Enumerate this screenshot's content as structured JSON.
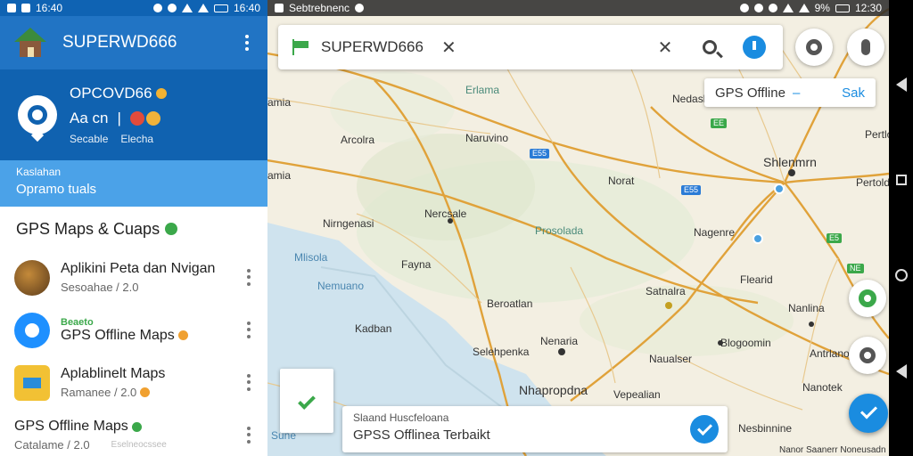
{
  "left_status": {
    "time": "16:40"
  },
  "map_status": {
    "title": "Sebtrebnenc",
    "battery": "9%",
    "time": "12:30"
  },
  "app": {
    "title": "SUPERWD666"
  },
  "profile": {
    "name": "OPCOVD66",
    "row": "Aa cn",
    "sub_left": "Secable",
    "sub_right": "Elecha"
  },
  "promo": {
    "small": "Kaslahan",
    "big": "Opramo tuals"
  },
  "list": {
    "header": "GPS Maps & Cuaps",
    "items": [
      {
        "tag": "",
        "title": "Aplikini Peta dan Nvigan",
        "sub": "Sesoahae / 2.0",
        "icon": "brown-app-icon"
      },
      {
        "tag": "Beaeto",
        "title": "GPS Offline Maps",
        "sub": "",
        "icon": "blue-app-icon"
      },
      {
        "tag": "",
        "title": "Aplablinelt Maps",
        "sub": "Ramanee / 2.0",
        "icon": "yellow-app-icon"
      },
      {
        "tag": "",
        "title": "GPS Offline Maps",
        "sub": "Catalame / 2.0",
        "icon": "map-app-icon"
      }
    ],
    "footer_watermark": "Eselneocssee"
  },
  "search": {
    "text": "SUPERWD666"
  },
  "chip": {
    "label": "GPS Offline",
    "sep": "–",
    "action": "Sak"
  },
  "toast": {
    "small": "Slaand Huscfeloana",
    "big": "GPSS Offlinea Terbaikt"
  },
  "map": {
    "labels": [
      {
        "text": "Erlama",
        "cls": "region"
      },
      {
        "text": "amia",
        "cls": ""
      },
      {
        "text": "Nedasla",
        "cls": ""
      },
      {
        "text": "Arcolra",
        "cls": ""
      },
      {
        "text": "Naruvino",
        "cls": ""
      },
      {
        "text": "Shlenmrn",
        "cls": "big"
      },
      {
        "text": "amia",
        "cls": ""
      },
      {
        "text": "Norat",
        "cls": ""
      },
      {
        "text": "Pertolde",
        "cls": ""
      },
      {
        "text": "Nercsale",
        "cls": ""
      },
      {
        "text": "Nirngenasi",
        "cls": ""
      },
      {
        "text": "Prosolada",
        "cls": "region"
      },
      {
        "text": "Nagenre",
        "cls": ""
      },
      {
        "text": "Mlisola",
        "cls": "water"
      },
      {
        "text": "Fayna",
        "cls": ""
      },
      {
        "text": "Flearid",
        "cls": ""
      },
      {
        "text": "Nemuano",
        "cls": "water"
      },
      {
        "text": "Beroatlan",
        "cls": ""
      },
      {
        "text": "Satnalra",
        "cls": ""
      },
      {
        "text": "Nanlina",
        "cls": ""
      },
      {
        "text": "Kadban",
        "cls": ""
      },
      {
        "text": "Nenaria",
        "cls": ""
      },
      {
        "text": "Blogoomin",
        "cls": ""
      },
      {
        "text": "Selehpenka",
        "cls": ""
      },
      {
        "text": "Naualser",
        "cls": ""
      },
      {
        "text": "Antrlano",
        "cls": ""
      },
      {
        "text": "Nhapropdna",
        "cls": "big"
      },
      {
        "text": "Vepealian",
        "cls": ""
      },
      {
        "text": "Nesbinnine",
        "cls": ""
      },
      {
        "text": "Sune",
        "cls": "water"
      },
      {
        "text": "Pertlo",
        "cls": ""
      },
      {
        "text": "Nanotek",
        "cls": ""
      },
      {
        "text": "Nanor Saanerr Noneusadn",
        "cls": ""
      }
    ],
    "shields": [
      {
        "text": "EE",
        "cls": "green"
      },
      {
        "text": "E55",
        "cls": "blue"
      },
      {
        "text": "E55",
        "cls": "blue"
      },
      {
        "text": "E5",
        "cls": "green"
      },
      {
        "text": "NE",
        "cls": "green"
      }
    ]
  },
  "colors": {
    "primary": "#2174c4",
    "primary_dark": "#1062b0",
    "accent": "#1a8ce0",
    "road": "#e0a23a",
    "green": "#3ba84a"
  }
}
